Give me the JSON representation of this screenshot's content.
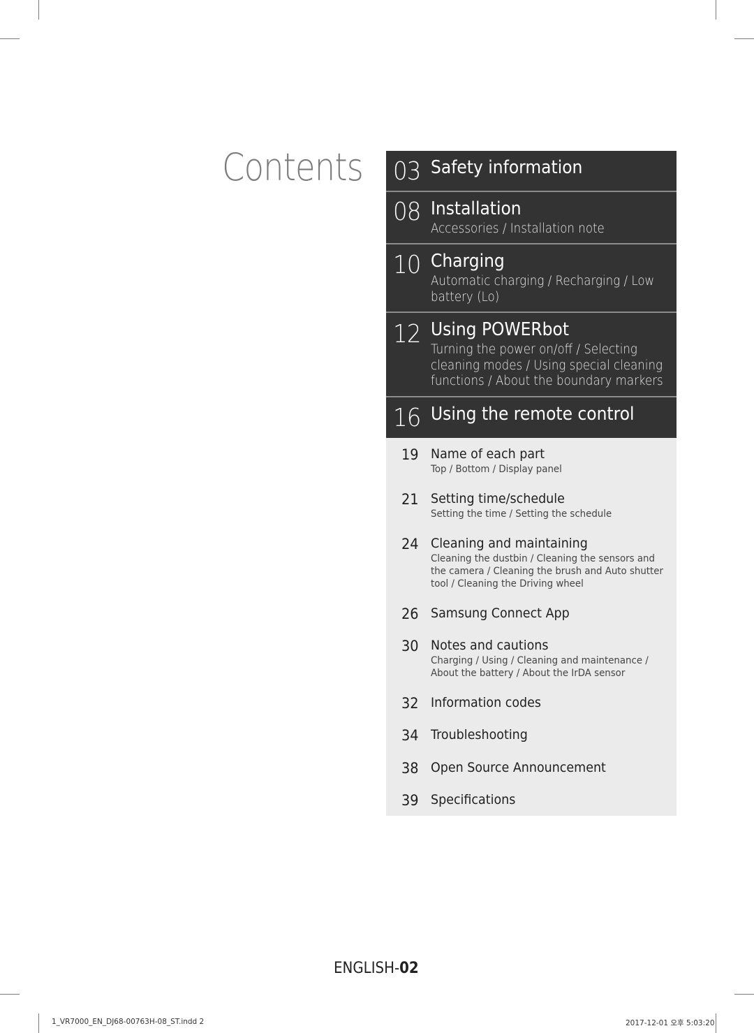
{
  "page_title": "Contents",
  "dark_sections": [
    {
      "page": "03",
      "title": "Safety information",
      "subtitle": ""
    },
    {
      "page": "08",
      "title": "Installation",
      "subtitle": "Accessories / Installation note"
    },
    {
      "page": "10",
      "title": "Charging",
      "subtitle": "Automatic charging / Recharging / Low battery (Lo)"
    },
    {
      "page": "12",
      "title": "Using POWERbot",
      "subtitle": "Turning the power on/off / Selecting cleaning modes / Using special cleaning functions / About the boundary markers"
    },
    {
      "page": "16",
      "title": "Using the remote control",
      "subtitle": ""
    }
  ],
  "light_sections": [
    {
      "page": "19",
      "title": "Name of each part",
      "subtitle": "Top / Bottom / Display panel"
    },
    {
      "page": "21",
      "title": "Setting time/schedule",
      "subtitle": "Setting the time / Setting the schedule"
    },
    {
      "page": "24",
      "title": "Cleaning and maintaining",
      "subtitle": "Cleaning the dustbin / Cleaning the sensors and the camera / Cleaning the brush and Auto shutter tool / Cleaning the Driving wheel"
    },
    {
      "page": "26",
      "title": "Samsung Connect App",
      "subtitle": ""
    },
    {
      "page": "30",
      "title": "Notes and cautions",
      "subtitle": "Charging / Using / Cleaning and maintenance / About the battery / About the IrDA sensor"
    },
    {
      "page": "32",
      "title": "Information codes",
      "subtitle": ""
    },
    {
      "page": "34",
      "title": "Troubleshooting",
      "subtitle": ""
    },
    {
      "page": "38",
      "title": "Open Source Announcement",
      "subtitle": ""
    },
    {
      "page": "39",
      "title": "Specifications",
      "subtitle": ""
    }
  ],
  "footer": {
    "language": "ENGLISH-",
    "page": "02",
    "slug_file": "1_VR7000_EN_DJ68-00763H-08_ST.indd   2",
    "slug_date": "2017-12-01   오후 5:03:20"
  },
  "colors": {
    "dark_panel": "#333333",
    "light_panel": "#ebebeb",
    "divider": "#8c8c8c",
    "title_gray": "#7b7b7b"
  }
}
